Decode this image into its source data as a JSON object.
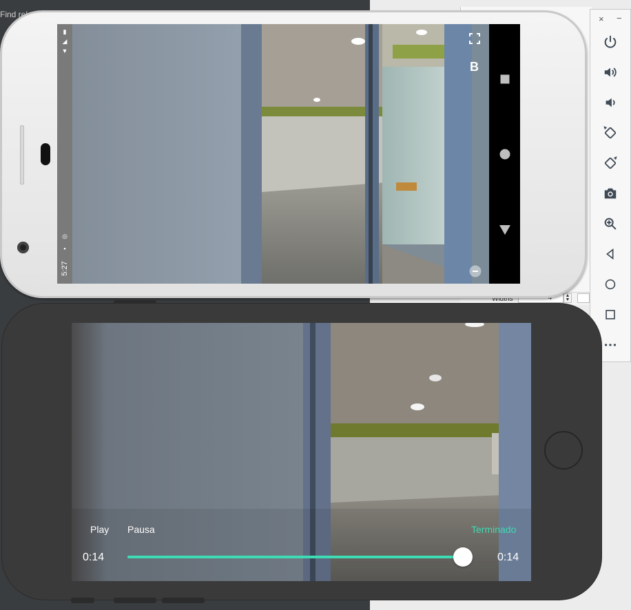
{
  "background": {
    "find_text": "Find rel",
    "widths_label": "Widths",
    "widths_value": "4"
  },
  "emulator_toolbar": {
    "close_label": "×",
    "minimize_label": "−",
    "buttons": [
      {
        "icon": "power-icon"
      },
      {
        "icon": "volume-up-icon"
      },
      {
        "icon": "volume-down-icon"
      },
      {
        "icon": "rotate-left-icon"
      },
      {
        "icon": "rotate-right-icon"
      },
      {
        "icon": "camera-icon"
      },
      {
        "icon": "zoom-icon"
      },
      {
        "icon": "back-icon"
      },
      {
        "icon": "home-icon"
      },
      {
        "icon": "overview-icon"
      },
      {
        "icon": "more-icon"
      }
    ]
  },
  "android": {
    "status_time": "5:27",
    "overlay_icons": [
      "fullscreen-icon",
      "brand-b-icon",
      "minus-icon"
    ],
    "nav_icons": [
      "recents-icon",
      "home-icon",
      "back-icon"
    ]
  },
  "ios_player": {
    "play_label": "Play",
    "pause_label": "Pausa",
    "status_label": "Terminado",
    "current_time": "0:14",
    "duration": "0:14",
    "progress": 0.99,
    "accent_color": "#3ddcb4"
  }
}
